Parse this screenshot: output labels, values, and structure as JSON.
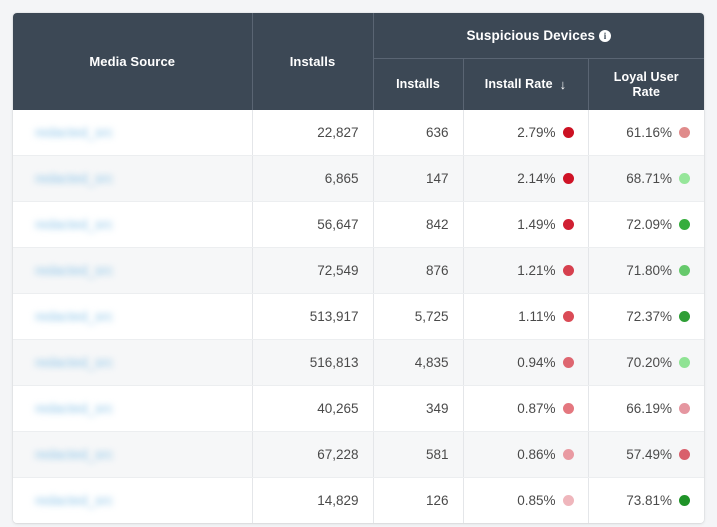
{
  "table": {
    "columns": {
      "media_source": "Media Source",
      "installs": "Installs",
      "group_title": "Suspicious Devices",
      "group_info_icon": "info-icon",
      "sub_installs": "Installs",
      "sub_install_rate": "Install Rate",
      "sort_arrow": "↓",
      "sub_loyal_user_rate_line1": "Loyal User",
      "sub_loyal_user_rate_line2": "Rate"
    },
    "header_bg": "#3c4855",
    "link_color": "#8ec5e8",
    "rows": [
      {
        "media_source": "redacted_src",
        "installs": "22,827",
        "sus_installs": "636",
        "install_rate": "2.79%",
        "install_rate_dot": "#cc1122",
        "loyal_user_rate": "61.16%",
        "loyal_user_rate_dot": "#e08b8b"
      },
      {
        "media_source": "redacted_src",
        "installs": "6,865",
        "sus_installs": "147",
        "install_rate": "2.14%",
        "install_rate_dot": "#cf1326",
        "loyal_user_rate": "68.71%",
        "loyal_user_rate_dot": "#96e69a"
      },
      {
        "media_source": "redacted_src",
        "installs": "56,647",
        "sus_installs": "842",
        "install_rate": "1.49%",
        "install_rate_dot": "#d01f32",
        "loyal_user_rate": "72.09%",
        "loyal_user_rate_dot": "#35ad3c"
      },
      {
        "media_source": "redacted_src",
        "installs": "72,549",
        "sus_installs": "876",
        "install_rate": "1.21%",
        "install_rate_dot": "#d6404e",
        "loyal_user_rate": "71.80%",
        "loyal_user_rate_dot": "#66c96c"
      },
      {
        "media_source": "redacted_src",
        "installs": "513,917",
        "sus_installs": "5,725",
        "install_rate": "1.11%",
        "install_rate_dot": "#da4b56",
        "loyal_user_rate": "72.37%",
        "loyal_user_rate_dot": "#2e9e35"
      },
      {
        "media_source": "redacted_src",
        "installs": "516,813",
        "sus_installs": "4,835",
        "install_rate": "0.94%",
        "install_rate_dot": "#de6670",
        "loyal_user_rate": "70.20%",
        "loyal_user_rate_dot": "#8fe394"
      },
      {
        "media_source": "redacted_src",
        "installs": "40,265",
        "sus_installs": "349",
        "install_rate": "0.87%",
        "install_rate_dot": "#e4777f",
        "loyal_user_rate": "66.19%",
        "loyal_user_rate_dot": "#e596a0"
      },
      {
        "media_source": "redacted_src",
        "installs": "67,228",
        "sus_installs": "581",
        "install_rate": "0.86%",
        "install_rate_dot": "#e99aa2",
        "loyal_user_rate": "57.49%",
        "loyal_user_rate_dot": "#d9606c"
      },
      {
        "media_source": "redacted_src",
        "installs": "14,829",
        "sus_installs": "126",
        "install_rate": "0.85%",
        "install_rate_dot": "#efb6bc",
        "loyal_user_rate": "73.81%",
        "loyal_user_rate_dot": "#1f9328"
      }
    ]
  }
}
